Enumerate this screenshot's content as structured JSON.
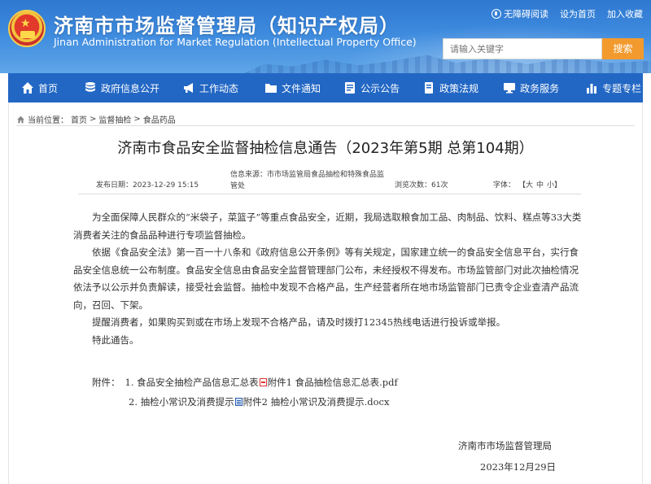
{
  "header": {
    "title": "济南市市场监督管理局（知识产权局）",
    "subtitle": "Jinan Administration for Market Regulation (Intellectual Property Office)",
    "toplinks": [
      "无障碍阅读",
      "设为首页",
      "加入收藏"
    ],
    "search_placeholder": "请输入关键字",
    "search_button": "搜索"
  },
  "nav": {
    "items": [
      {
        "label": "首页",
        "icon": "home-icon"
      },
      {
        "label": "政府信息公开",
        "icon": "database-icon"
      },
      {
        "label": "工作动态",
        "icon": "megaphone-icon"
      },
      {
        "label": "文件通知",
        "icon": "folder-icon"
      },
      {
        "label": "公示公告",
        "icon": "notice-icon"
      },
      {
        "label": "政策法规",
        "icon": "book-icon"
      },
      {
        "label": "政务服务",
        "icon": "monitor-icon"
      },
      {
        "label": "专题专栏",
        "icon": "chart-icon"
      }
    ]
  },
  "breadcrumb": {
    "prefix": "当前位置：",
    "items": [
      "首页",
      "监督抽检",
      "食品药品"
    ],
    "separator": ">"
  },
  "article": {
    "title": "济南市食品安全监督抽检信息通告（2023年第5期 总第104期）",
    "date": "发布日期：2023-12-29 15:15",
    "source": "信息来源：市市场监管局食品抽检和特殊食品监管处",
    "views": "浏览次数：61次",
    "font_label": "字体：",
    "font_sizes": [
      "【大",
      "中",
      "小】"
    ],
    "paragraphs": [
      "为全面保障人民群众的“米袋子，菜篮子”等重点食品安全，近期，我局选取粮食加工品、肉制品、饮料、糕点等33大类消费者关注的食品品种进行专项监督抽检。",
      "依据《食品安全法》第一百一十八条和《政府信息公开条例》等有关规定，国家建立统一的食品安全信息平台，实行食品安全信息统一公布制度。食品安全信息由食品安全监督管理部门公布，未经授权不得发布。市场监管部门对此次抽检情况依法予以公示并负责解读，接受社会监督。抽检中发现不合格产品，生产经营者所在地市场监管部门已责令企业查清产品流向，召回、下架。",
      "提醒消费者，如果购买到或在市场上发现不合格产品，请及时拨打12345热线电话进行投诉或举报。",
      "特此通告。"
    ],
    "attachments_label": "附件：",
    "attachments": [
      {
        "prefix": "1. 食品安全抽检产品信息汇总表",
        "link": "附件1 食品抽检信息汇总表.pdf",
        "icon": "pdf-icon"
      },
      {
        "prefix": "2. 抽检小常识及消费提示",
        "link": "附件2 抽检小常识及消费提示.docx",
        "icon": "doc-icon"
      }
    ],
    "signature_org": "济南市市场监督管理局",
    "signature_date": "2023年12月29日"
  }
}
